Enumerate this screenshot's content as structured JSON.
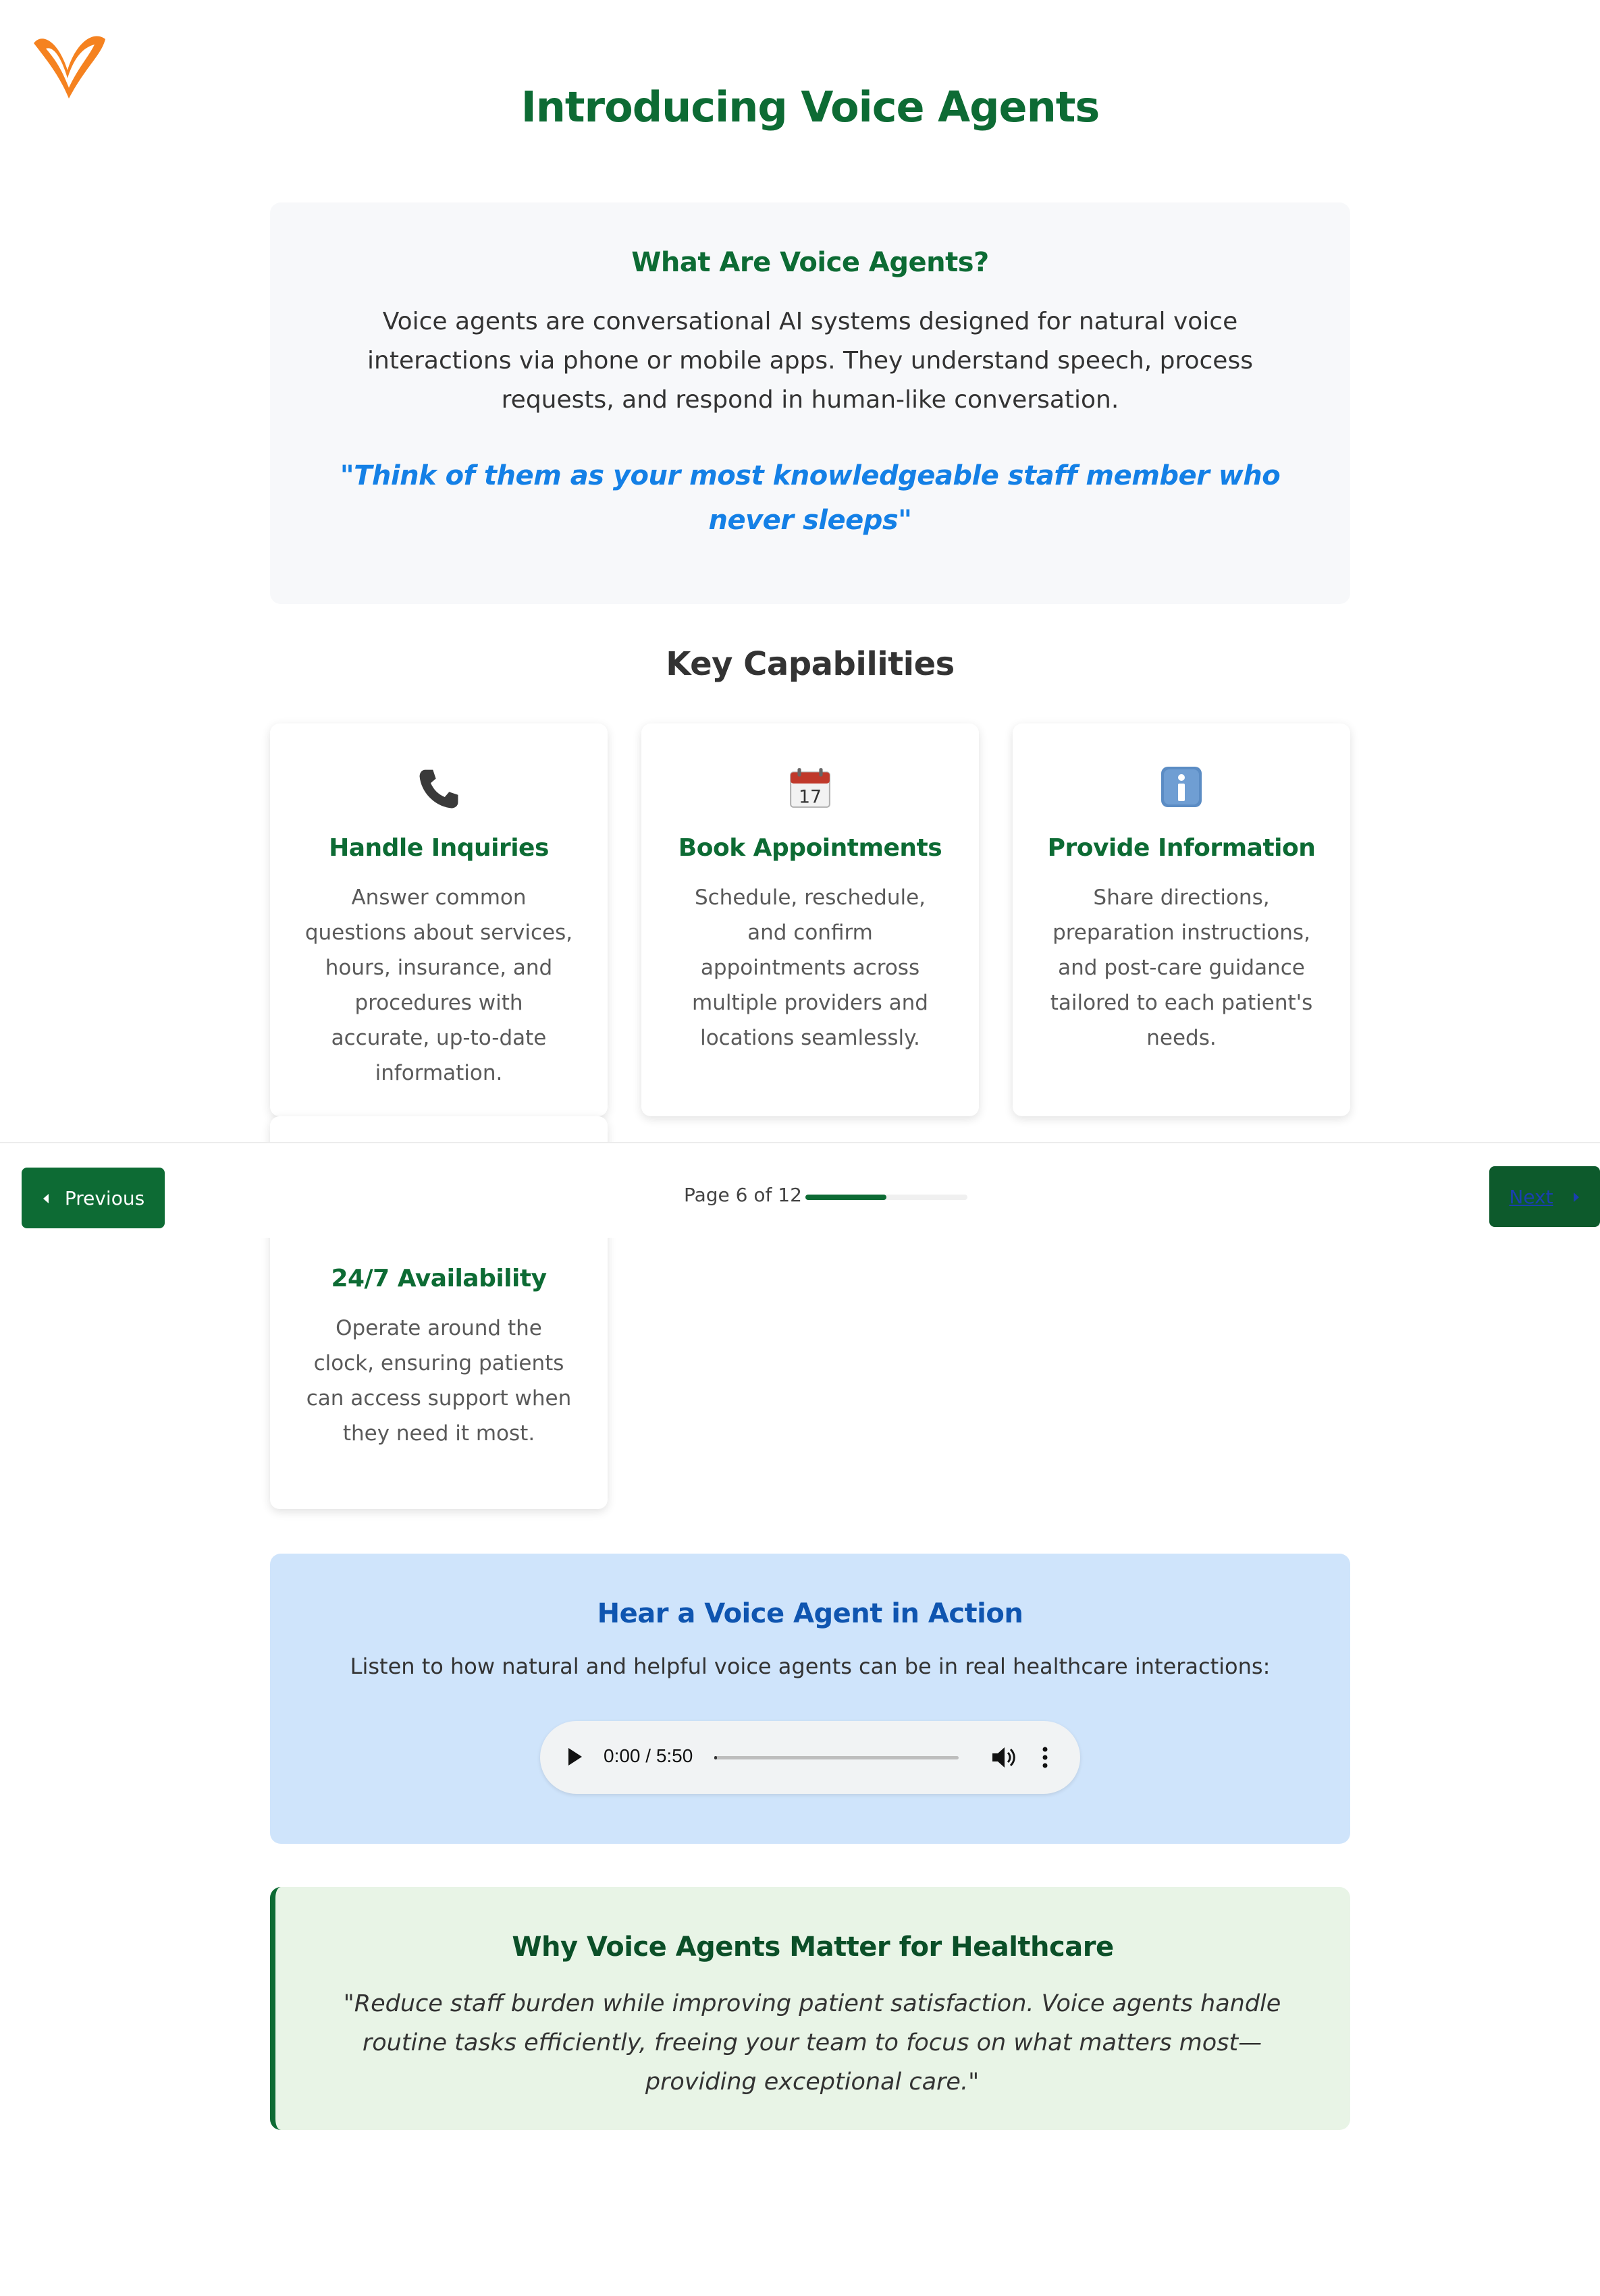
{
  "header": {
    "title": "Introducing Voice Agents"
  },
  "intro": {
    "heading": "What Are Voice Agents?",
    "body": "Voice agents are conversational AI systems designed for natural voice interactions via phone or mobile apps. They understand speech, process requests, and respond in human-like conversation.",
    "quote": "\"Think of them as your most knowledgeable staff member who never sleeps\""
  },
  "capabilities": {
    "heading": "Key Capabilities",
    "cards": [
      {
        "icon": "telephone-icon",
        "title": "Handle Inquiries",
        "description": "Answer common questions about services, hours, insurance, and procedures with accurate, up-to-date information."
      },
      {
        "icon": "calendar-icon",
        "title": "Book Appointments",
        "description": "Schedule, reschedule, and confirm appointments across multiple providers and locations seamlessly."
      },
      {
        "icon": "information-icon",
        "title": "Provide Information",
        "description": "Share directions, preparation instructions, and post-care guidance tailored to each patient's needs."
      },
      {
        "icon": "clock-icon",
        "title": "24/7 Availability",
        "description": "Operate around the clock, ensuring patients can access support when they need it most."
      }
    ]
  },
  "navigation": {
    "previous_label": "Previous",
    "next_label": "Next",
    "page_indicator": "Page 6 of 12",
    "current_page": 6,
    "total_pages": 12
  },
  "audio_section": {
    "heading": "Hear a Voice Agent in Action",
    "description": "Listen to how natural and helpful voice agents can be in real healthcare interactions:",
    "player": {
      "time": "0:00 / 5:50",
      "progress": 0
    }
  },
  "why_section": {
    "heading": "Why Voice Agents Matter for Healthcare",
    "quote": "\"Reduce staff burden while improving patient satisfaction. Voice agents handle routine tasks efficiently, freeing your team to focus on what matters most—providing exceptional care.\""
  },
  "colors": {
    "brand_green": "#0d6b34",
    "quote_blue": "#1480e6",
    "logo_orange": "#f58220"
  }
}
